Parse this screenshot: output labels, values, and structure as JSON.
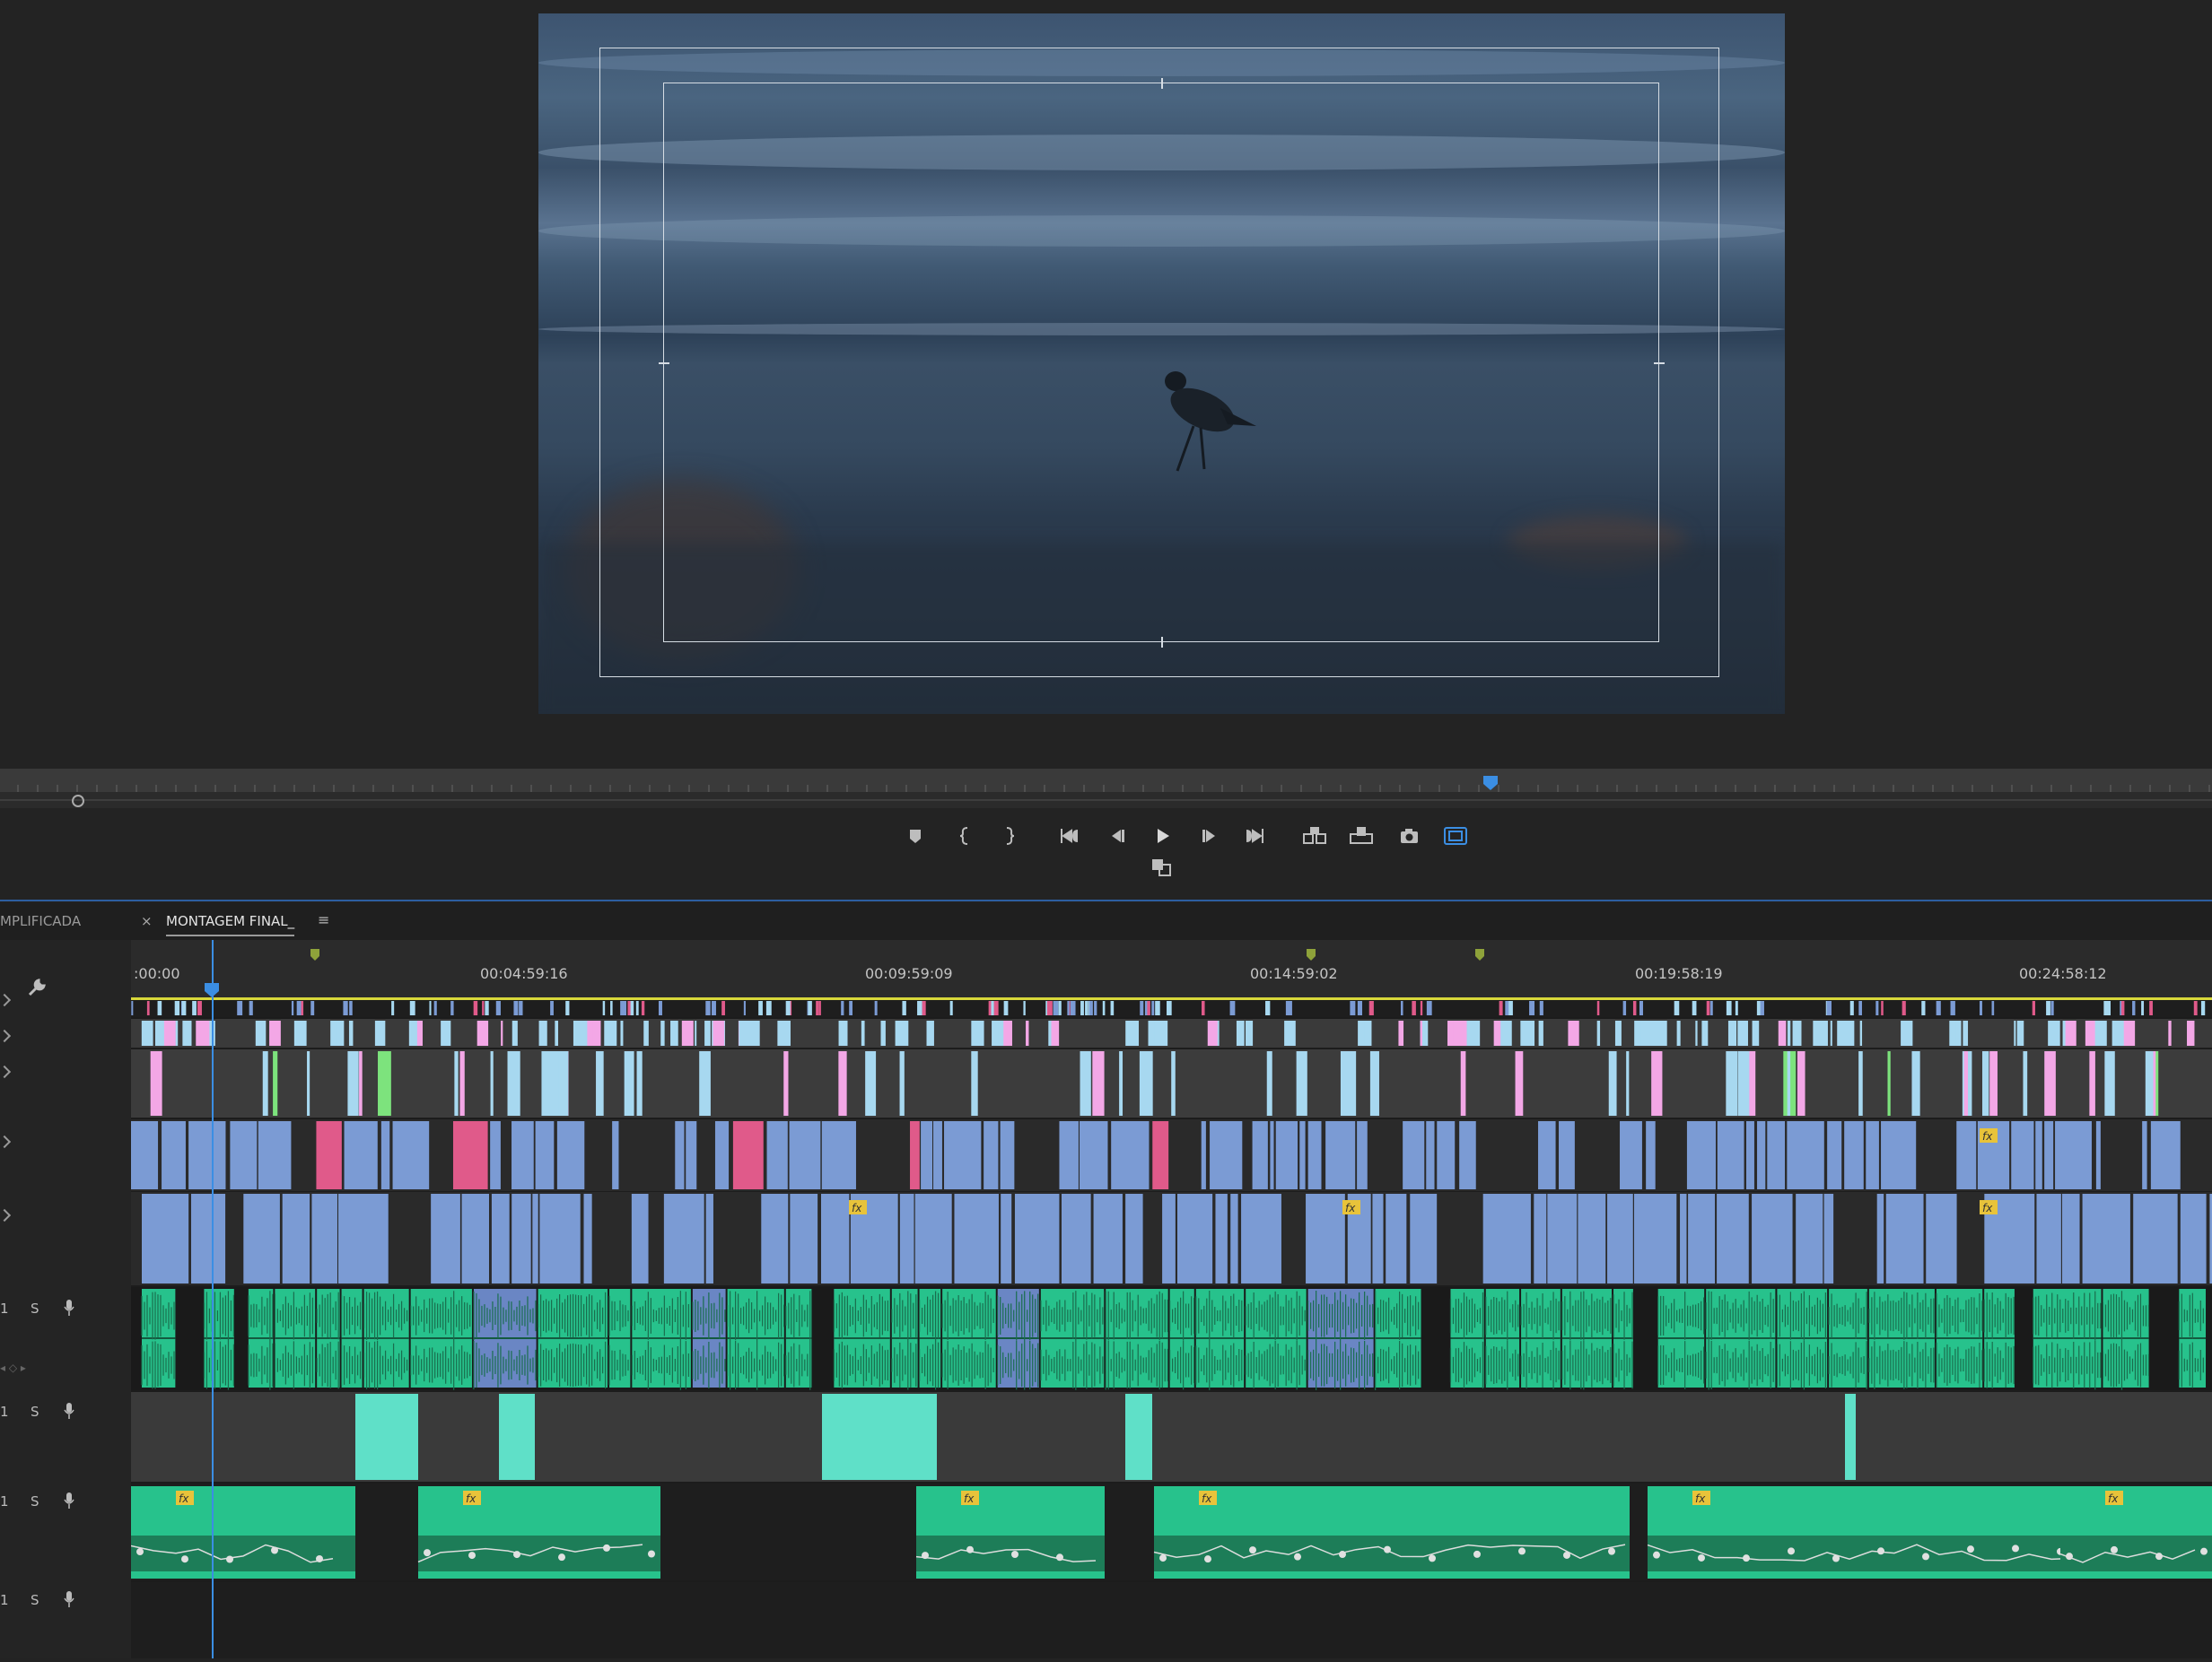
{
  "tabs": [
    {
      "label": "MPLIFICADA",
      "active": false
    },
    {
      "label": "MONTAGEM FINAL_",
      "active": true,
      "close": "×",
      "menu": "≡"
    }
  ],
  "ruler": {
    "labels": [
      ":00:00",
      "00:04:59:16",
      "00:09:59:09",
      "00:14:59:02",
      "00:19:58:19",
      "00:24:58:12"
    ]
  },
  "track_headers": {
    "audio_rows": [
      {
        "num": "1",
        "solo": "S"
      },
      {
        "num": "1",
        "solo": "S"
      },
      {
        "num": "1",
        "solo": "S"
      },
      {
        "num": "1",
        "solo": "S"
      }
    ]
  },
  "controls": {
    "icons": [
      "marker-icon",
      "mark-in-icon",
      "mark-out-icon",
      "go-to-in-icon",
      "step-back-icon",
      "play-icon",
      "step-forward-icon",
      "go-to-out-icon",
      "insert-icon",
      "overwrite-icon",
      "camera-icon",
      "safe-margins-icon",
      "compare-icon"
    ]
  },
  "colors": {
    "video_clip": "#7b9bd4",
    "audio_clip": "#27c28c",
    "audio_dark": "#1a6e4e",
    "pink_clip": "#f3a7e6",
    "light_clip": "#a7d8f0",
    "playhead": "#3b8ee3",
    "fx_badge": "#e8c33a"
  }
}
